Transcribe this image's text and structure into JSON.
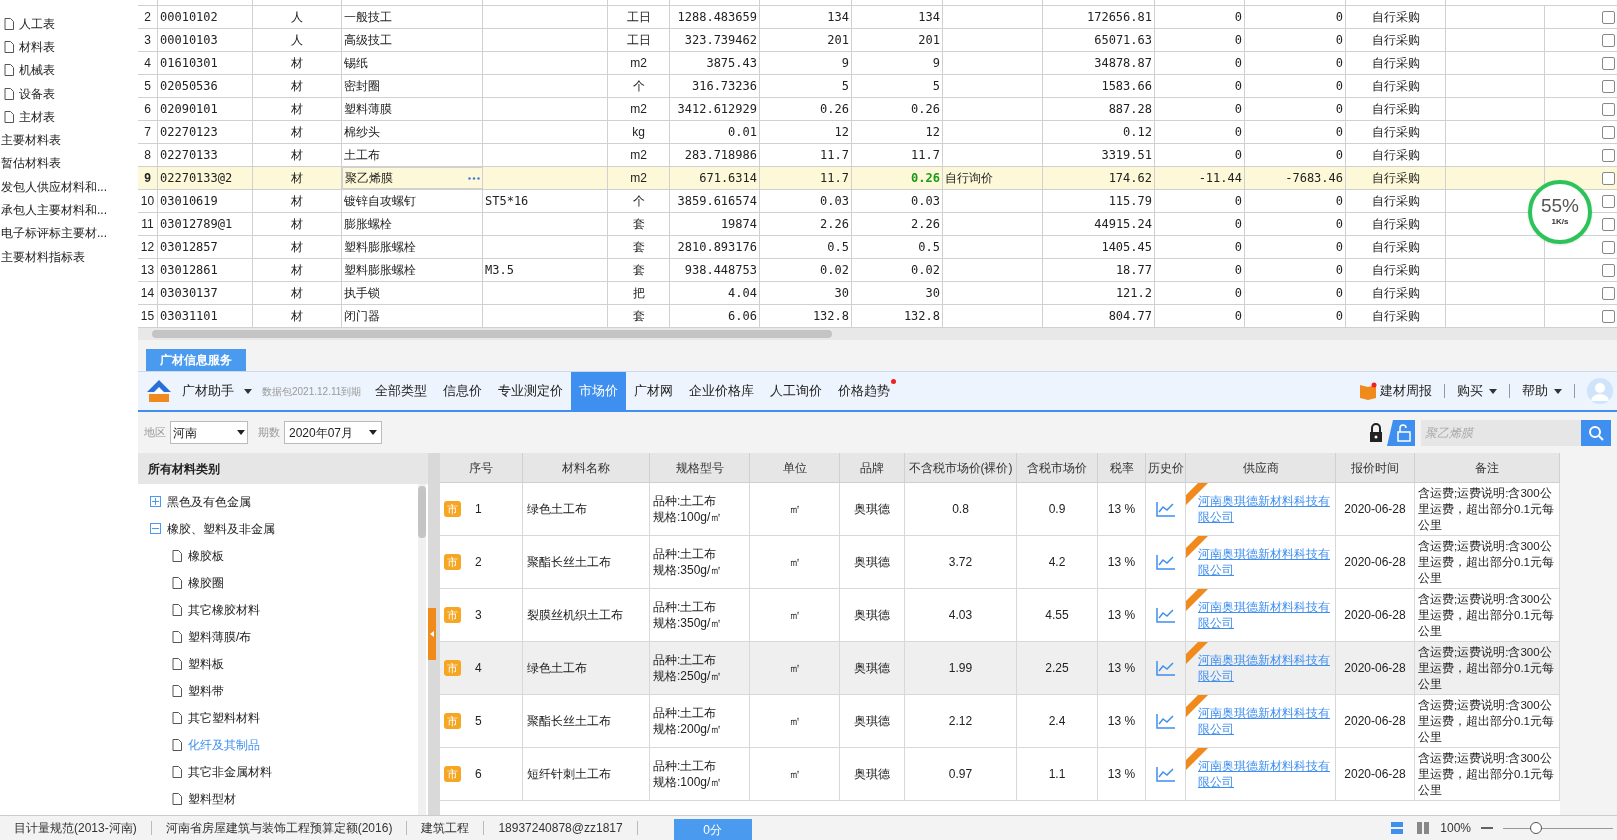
{
  "sidebar": {
    "items": [
      {
        "label": "人工表",
        "kind": "doc"
      },
      {
        "label": "材料表",
        "kind": "doc"
      },
      {
        "label": "机械表",
        "kind": "doc"
      },
      {
        "label": "设备表",
        "kind": "doc"
      },
      {
        "label": "主材表",
        "kind": "doc"
      },
      {
        "label": "主要材料表",
        "kind": "plain"
      },
      {
        "label": "暂估材料表",
        "kind": "plain"
      },
      {
        "label": "发包人供应材料和...",
        "kind": "plain"
      },
      {
        "label": "承包人主要材料和...",
        "kind": "plain"
      },
      {
        "label": "电子标评标主要材...",
        "kind": "plain"
      },
      {
        "label": "主要材料指标表",
        "kind": "plain"
      }
    ]
  },
  "resource_table": {
    "rows": [
      {
        "cells": [
          "2",
          "00010102",
          "人",
          "一般技工",
          "",
          "工日",
          "1288.483659",
          "134",
          "134",
          "",
          "172656.81",
          "0",
          "0",
          "自行采购"
        ],
        "selected": false,
        "checked": false
      },
      {
        "cells": [
          "3",
          "00010103",
          "人",
          "高级技工",
          "",
          "工日",
          "323.739462",
          "201",
          "201",
          "",
          "65071.63",
          "0",
          "0",
          "自行采购"
        ],
        "selected": false,
        "checked": false
      },
      {
        "cells": [
          "4",
          "01610301",
          "材",
          "锡纸",
          "",
          "m2",
          "3875.43",
          "9",
          "9",
          "",
          "34878.87",
          "0",
          "0",
          "自行采购"
        ],
        "selected": false,
        "checked": false
      },
      {
        "cells": [
          "5",
          "02050536",
          "材",
          "密封圈",
          "",
          "个",
          "316.73236",
          "5",
          "5",
          "",
          "1583.66",
          "0",
          "0",
          "自行采购"
        ],
        "selected": false,
        "checked": false
      },
      {
        "cells": [
          "6",
          "02090101",
          "材",
          "塑料薄膜",
          "",
          "m2",
          "3412.612929",
          "0.26",
          "0.26",
          "",
          "887.28",
          "0",
          "0",
          "自行采购"
        ],
        "selected": false,
        "checked": false
      },
      {
        "cells": [
          "7",
          "02270123",
          "材",
          "棉纱头",
          "",
          "kg",
          "0.01",
          "12",
          "12",
          "",
          "0.12",
          "0",
          "0",
          "自行采购"
        ],
        "selected": false,
        "checked": false
      },
      {
        "cells": [
          "8",
          "02270133",
          "材",
          "土工布",
          "",
          "m2",
          "283.718986",
          "11.7",
          "11.7",
          "",
          "3319.51",
          "0",
          "0",
          "自行采购"
        ],
        "selected": false,
        "checked": false
      },
      {
        "cells": [
          "9",
          "02270133@2",
          "材",
          "聚乙烯膜",
          "",
          "m2",
          "671.6314",
          "11.7",
          "0.26",
          "自行询价",
          "174.62",
          "-11.44",
          "-7683.46",
          "自行采购"
        ],
        "selected": true,
        "checked": false
      },
      {
        "cells": [
          "10",
          "03010619",
          "材",
          "镀锌自攻螺钉",
          "ST5*16",
          "个",
          "3859.616574",
          "0.03",
          "0.03",
          "",
          "115.79",
          "0",
          "0",
          "自行采购"
        ],
        "selected": false,
        "checked": false
      },
      {
        "cells": [
          "11",
          "03012789@1",
          "材",
          "膨胀螺栓",
          "",
          "套",
          "19874",
          "2.26",
          "2.26",
          "",
          "44915.24",
          "0",
          "0",
          "自行采购"
        ],
        "selected": false,
        "checked": false
      },
      {
        "cells": [
          "12",
          "03012857",
          "材",
          "塑料膨胀螺栓",
          "",
          "套",
          "2810.893176",
          "0.5",
          "0.5",
          "",
          "1405.45",
          "0",
          "0",
          "自行采购"
        ],
        "selected": false,
        "checked": false
      },
      {
        "cells": [
          "13",
          "03012861",
          "材",
          "塑料膨胀螺栓",
          "M3.5",
          "套",
          "938.448753",
          "0.02",
          "0.02",
          "",
          "18.77",
          "0",
          "0",
          "自行采购"
        ],
        "selected": false,
        "checked": false
      },
      {
        "cells": [
          "14",
          "03030137",
          "材",
          "执手锁",
          "",
          "把",
          "4.04",
          "30",
          "30",
          "",
          "121.2",
          "0",
          "0",
          "自行采购"
        ],
        "selected": false,
        "checked": false
      },
      {
        "cells": [
          "15",
          "03031101",
          "材",
          "闭门器",
          "",
          "套",
          "6.06",
          "132.8",
          "132.8",
          "",
          "804.77",
          "0",
          "0",
          "自行采购"
        ],
        "selected": false,
        "checked": false
      }
    ]
  },
  "speed_widget": {
    "percent": "55%",
    "rate": "1K/s"
  },
  "panel_tab": "广材信息服务",
  "toolbar": {
    "app": "广材助手",
    "expiry": "数据包2021.12.11到期",
    "tabs": [
      {
        "label": "全部类型",
        "selected": false,
        "dot": false
      },
      {
        "label": "信息价",
        "selected": false,
        "dot": false
      },
      {
        "label": "专业测定价",
        "selected": false,
        "dot": false
      },
      {
        "label": "市场价",
        "selected": true,
        "dot": false
      },
      {
        "label": "广材网",
        "selected": false,
        "dot": false
      },
      {
        "label": "企业价格库",
        "selected": false,
        "dot": false
      },
      {
        "label": "人工询价",
        "selected": false,
        "dot": false
      },
      {
        "label": "价格趋势",
        "selected": false,
        "dot": true
      }
    ],
    "weekly": "建材周报",
    "buy": "购买",
    "help": "帮助"
  },
  "filters": {
    "region_label": "地区",
    "region": "河南",
    "period_label": "期数",
    "period": "2020年07月",
    "search_placeholder": "聚乙烯膜"
  },
  "categories": {
    "title": "所有材料类别",
    "tree": [
      {
        "label": "黑色及有色金属",
        "expanded": false,
        "selected": false
      },
      {
        "label": "橡胶、塑料及非金属",
        "expanded": true,
        "selected": false,
        "children": [
          {
            "label": "橡胶板",
            "selected": false
          },
          {
            "label": "橡胶圈",
            "selected": false
          },
          {
            "label": "其它橡胶材料",
            "selected": false
          },
          {
            "label": "塑料薄膜/布",
            "selected": false
          },
          {
            "label": "塑料板",
            "selected": false
          },
          {
            "label": "塑料带",
            "selected": false
          },
          {
            "label": "其它塑料材料",
            "selected": false
          },
          {
            "label": "化纤及其制品",
            "selected": true
          },
          {
            "label": "其它非金属材料",
            "selected": false
          },
          {
            "label": "塑料型材",
            "selected": false
          }
        ]
      }
    ]
  },
  "price_table": {
    "columns": [
      "序号",
      "材料名称",
      "规格型号",
      "单位",
      "品牌",
      "不含税市场价(裸价)",
      "含税市场价",
      "税率",
      "历史价",
      "供应商",
      "报价时间",
      "备注"
    ],
    "rows": [
      {
        "badge": "市",
        "seq": "1",
        "name": "绿色土工布",
        "spec": [
          "品种:土工布",
          "规格:100g/㎡"
        ],
        "unit": "㎡",
        "brand": "奥琪德",
        "price_ex": "0.8",
        "price_in": "0.9",
        "tax": "13 %",
        "supplier": "河南奥琪德新材料科技有限公司",
        "time": "2020-06-28",
        "note": "含运费;运费说明:含300公里运费，超出部分0.1元每公里",
        "selected": false
      },
      {
        "badge": "市",
        "seq": "2",
        "name": "聚酯长丝土工布",
        "spec": [
          "品种:土工布",
          "规格:350g/㎡"
        ],
        "unit": "㎡",
        "brand": "奥琪德",
        "price_ex": "3.72",
        "price_in": "4.2",
        "tax": "13 %",
        "supplier": "河南奥琪德新材料科技有限公司",
        "time": "2020-06-28",
        "note": "含运费;运费说明:含300公里运费，超出部分0.1元每公里",
        "selected": false
      },
      {
        "badge": "市",
        "seq": "3",
        "name": "裂膜丝机织土工布",
        "spec": [
          "品种:土工布",
          "规格:350g/㎡"
        ],
        "unit": "㎡",
        "brand": "奥琪德",
        "price_ex": "4.03",
        "price_in": "4.55",
        "tax": "13 %",
        "supplier": "河南奥琪德新材料科技有限公司",
        "time": "2020-06-28",
        "note": "含运费;运费说明:含300公里运费，超出部分0.1元每公里",
        "selected": false
      },
      {
        "badge": "市",
        "seq": "4",
        "name": "绿色土工布",
        "spec": [
          "品种:土工布",
          "规格:250g/㎡"
        ],
        "unit": "㎡",
        "brand": "奥琪德",
        "price_ex": "1.99",
        "price_in": "2.25",
        "tax": "13 %",
        "supplier": "河南奥琪德新材料科技有限公司",
        "time": "2020-06-28",
        "note": "含运费;运费说明:含300公里运费，超出部分0.1元每公里",
        "selected": true
      },
      {
        "badge": "市",
        "seq": "5",
        "name": "聚酯长丝土工布",
        "spec": [
          "品种:土工布",
          "规格:200g/㎡"
        ],
        "unit": "㎡",
        "brand": "奥琪德",
        "price_ex": "2.12",
        "price_in": "2.4",
        "tax": "13 %",
        "supplier": "河南奥琪德新材料科技有限公司",
        "time": "2020-06-28",
        "note": "含运费;运费说明:含300公里运费，超出部分0.1元每公里",
        "selected": false
      },
      {
        "badge": "市",
        "seq": "6",
        "name": "短纤针刺土工布",
        "spec": [
          "品种:土工布",
          "规格:100g/㎡"
        ],
        "unit": "㎡",
        "brand": "奥琪德",
        "price_ex": "0.97",
        "price_in": "1.1",
        "tax": "13 %",
        "supplier": "河南奥琪德新材料科技有限公司",
        "time": "2020-06-28",
        "note": "含运费;运费说明:含300公里运费，超出部分0.1元每公里",
        "selected": false
      }
    ]
  },
  "status_bar": {
    "items": [
      "目计量规范(2013-河南)",
      "河南省房屋建筑与装饰工程预算定额(2016)",
      "建筑工程",
      "18937240878@zz1817"
    ],
    "score": "0分",
    "zoom": "100%",
    "zoom_slider": {
      "level": 0.3
    }
  }
}
